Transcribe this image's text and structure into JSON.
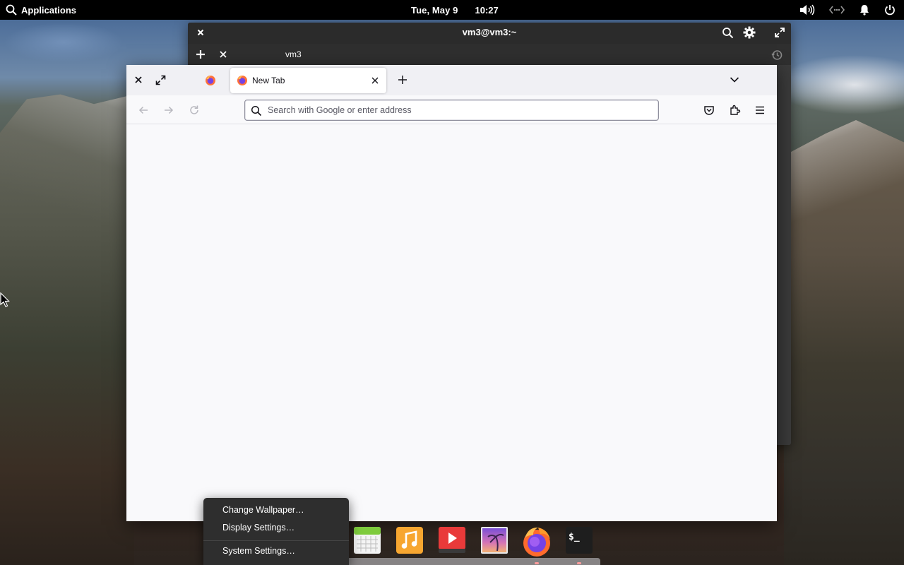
{
  "top_panel": {
    "applications_label": "Applications",
    "date": "Tue, May  9",
    "time": "10:27"
  },
  "terminal": {
    "title": "vm3@vm3:~",
    "tab_label": "vm3"
  },
  "firefox": {
    "tab_title": "New Tab",
    "url_placeholder": "Search with Google or enter address",
    "url_value": ""
  },
  "context_menu": {
    "items": [
      "Change Wallpaper…",
      "Display Settings…",
      "System Settings…"
    ]
  },
  "dock": {
    "apps": [
      "calendar-app",
      "music-app",
      "videos-app",
      "photos-app",
      "firefox-app",
      "terminal-app"
    ]
  },
  "colors": {
    "panel_bg": "#000000",
    "terminal_bg": "#383838",
    "firefox_bg": "#f9f9fb",
    "menu_bg": "#2e2e2e",
    "accent_orange": "#f7a630",
    "video_red": "#e93a3a"
  }
}
